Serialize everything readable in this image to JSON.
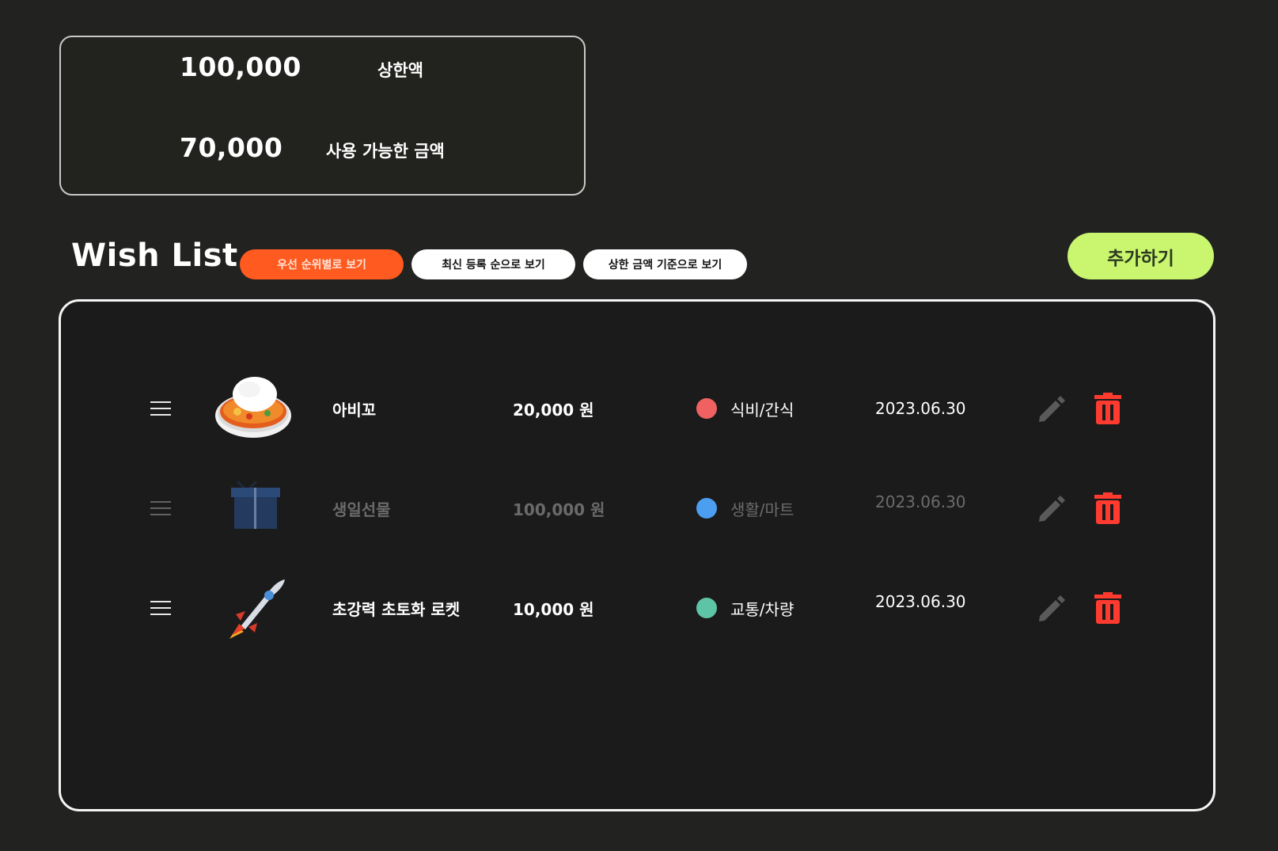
{
  "budget": {
    "limit_amount": "100,000",
    "limit_label": "상한액",
    "available_amount": "70,000",
    "available_label": "사용 가능한 금액"
  },
  "wishlist": {
    "title": "Wish List",
    "sort_options": [
      "우선 순위별로 보기",
      "최신 등록 순으로 보기",
      "상한 금액 기준으로 보기"
    ],
    "active_sort": "우선 순위별로 보기",
    "add_button": "추가하기",
    "items": [
      {
        "name": "아비꼬",
        "icon": "curry-rice-icon",
        "price": "20,000 원",
        "category": "식비/간식",
        "category_color": "#f06262",
        "date": "2023.06.30",
        "dimmed": false
      },
      {
        "name": "생일선물",
        "icon": "gift-box-icon",
        "price": "100,000 원",
        "category": "생활/마트",
        "category_color": "#4c9ef0",
        "date": "2023.06.30",
        "dimmed": true
      },
      {
        "name": "초강력 초토화 로켓",
        "icon": "rocket-icon",
        "price": "10,000 원",
        "category": "교통/차량",
        "category_color": "#5ec4a6",
        "date": "2023.06.30",
        "dimmed": false
      }
    ]
  },
  "colors": {
    "background": "#222320",
    "accent_orange": "#ff5a1f",
    "accent_lime": "#c9f56f",
    "delete_red": "#ff3b30",
    "edit_gray": "#5a5a5a"
  }
}
